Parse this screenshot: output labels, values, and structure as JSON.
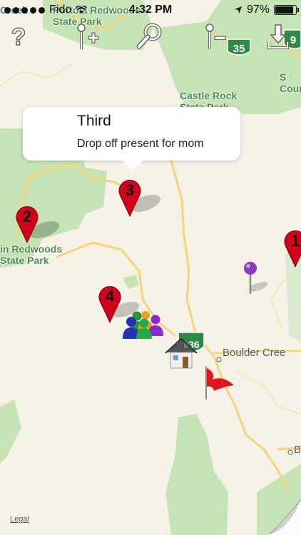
{
  "status_bar": {
    "carrier": "Fido",
    "time": "4:32 PM",
    "battery": "97%",
    "battery_level": 0.97
  },
  "toolbar": {
    "help_icon": "question-mark-icon",
    "add_pin_icon": "add-pin-icon",
    "search_icon": "magnifier-icon",
    "remove_pin_icon": "remove-pin-icon",
    "download_icon": "download-icon"
  },
  "callout": {
    "title": "Third",
    "subtitle": "Drop off present for mom"
  },
  "pins": [
    {
      "label": "1",
      "color": "#d0021b"
    },
    {
      "label": "2",
      "color": "#d0021b"
    },
    {
      "label": "3",
      "color": "#d0021b"
    },
    {
      "label": "4",
      "color": "#d0021b"
    }
  ],
  "map_labels": {
    "portola": "Portola Redwoods\nState Park",
    "castle_rock": "Castle Rock\nState Park",
    "redwoods_left": "in Redwoods\nState Park",
    "creek_top": "Creek",
    "county": "S\nCoun",
    "boulder_creek": "Boulder Cree",
    "b_right": "B"
  },
  "highways": [
    "35",
    "9",
    "236"
  ],
  "legal": "Legal",
  "colors": {
    "pin_red": "#d0021b",
    "park_green": "#c5e3b5",
    "road_yellow": "#f5d47a",
    "map_bg": "#f6f2e8",
    "flag_red": "#e0161f",
    "purple_pin": "#8a3ab9"
  }
}
